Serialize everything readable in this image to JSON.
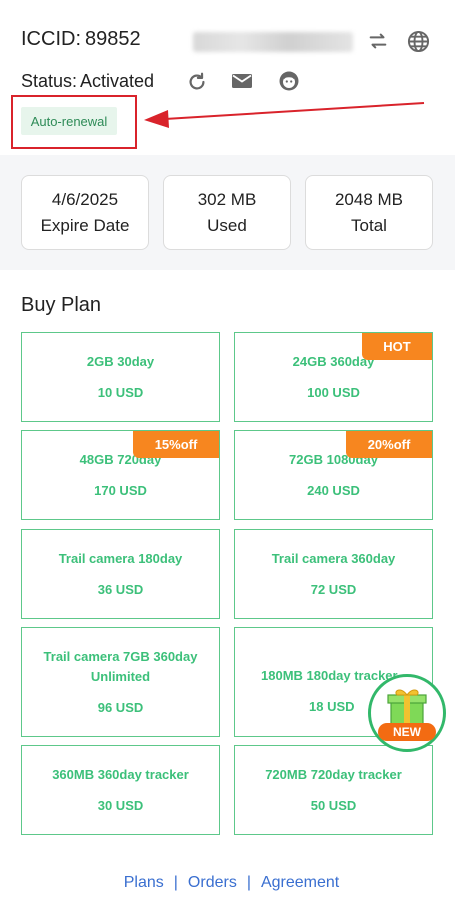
{
  "header": {
    "iccid_label": "ICCID:",
    "iccid_value": "89852",
    "status_label": "Status:",
    "status_value": "Activated",
    "icons": [
      "swap-icon",
      "globe-icon",
      "refresh-icon",
      "mail-icon",
      "support-icon"
    ]
  },
  "badge": {
    "label": "Auto-renewal"
  },
  "stats": [
    {
      "value": "4/6/2025",
      "label": "Expire Date"
    },
    {
      "value": "302 MB",
      "label": "Used"
    },
    {
      "value": "2048 MB",
      "label": "Total"
    }
  ],
  "buy_plan": {
    "title": "Buy Plan",
    "plans": [
      {
        "name": "2GB 30day",
        "price": "10 USD",
        "tag": ""
      },
      {
        "name": "24GB 360day",
        "price": "100 USD",
        "tag": "HOT"
      },
      {
        "name": "48GB 720day",
        "price": "170 USD",
        "tag": "15%off"
      },
      {
        "name": "72GB 1080day",
        "price": "240 USD",
        "tag": "20%off"
      },
      {
        "name": "Trail camera 180day",
        "price": "36 USD",
        "tag": ""
      },
      {
        "name": "Trail camera 360day",
        "price": "72 USD",
        "tag": ""
      },
      {
        "name": "Trail camera 7GB 360day Unlimited",
        "price": "96 USD",
        "tag": ""
      },
      {
        "name": "180MB 180day tracker",
        "price": "18 USD",
        "tag": ""
      },
      {
        "name": "360MB 360day tracker",
        "price": "30 USD",
        "tag": ""
      },
      {
        "name": "720MB 720day tracker",
        "price": "50 USD",
        "tag": ""
      }
    ]
  },
  "gift": {
    "label": "NEW",
    "icon": "gift-icon"
  },
  "footer": {
    "links": [
      "Plans",
      "Orders",
      "Agreement"
    ],
    "separator": "|"
  },
  "colors": {
    "accent_green": "#3cc07a",
    "tag_orange": "#f7861f",
    "link_blue": "#3a6fd0",
    "annotation_red": "#d9232b"
  }
}
